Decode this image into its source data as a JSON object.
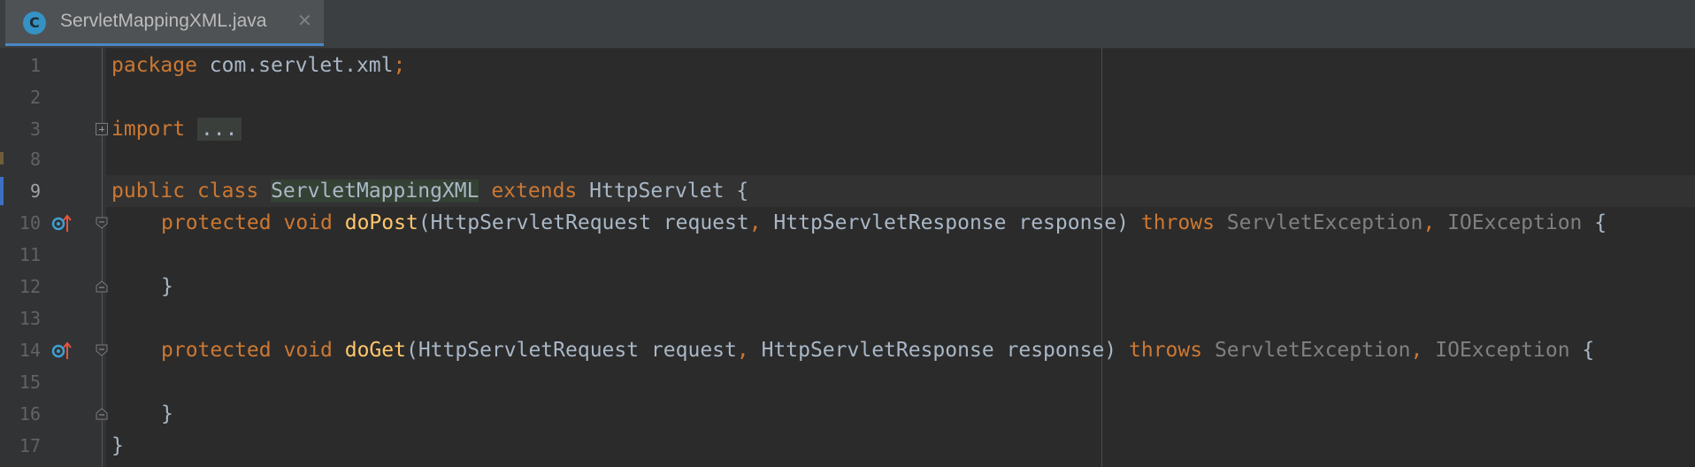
{
  "tab": {
    "icon_letter": "C",
    "file_name": "ServletMappingXML.java",
    "close_glyph": "✕",
    "icon_color": "#3592c4"
  },
  "editor": {
    "active_line": "9",
    "lines": [
      {
        "no": "1"
      },
      {
        "no": "2"
      },
      {
        "no": "3"
      },
      {
        "no": "8"
      },
      {
        "no": "9"
      },
      {
        "no": "10"
      },
      {
        "no": "11"
      },
      {
        "no": "12"
      },
      {
        "no": "13"
      },
      {
        "no": "14"
      },
      {
        "no": "15"
      },
      {
        "no": "16"
      },
      {
        "no": "17"
      }
    ],
    "code": {
      "l1": {
        "kw": "package",
        "pkg": "com.servlet.xml",
        "semi": ";"
      },
      "l3": {
        "kw": "import",
        "dots": "..."
      },
      "l9": {
        "kw_public": "public",
        "kw_class": "class",
        "class_name": "ServletMappingXML",
        "kw_extends": "extends",
        "parent": "HttpServlet",
        "brace": "{"
      },
      "l10": {
        "kw_protected": "protected",
        "kw_void": "void",
        "method": "doPost",
        "params_open": "(HttpServletRequest request",
        "comma": ",",
        "params_rest": " HttpServletResponse response)",
        "kw_throws": "throws",
        "exc1": "ServletException",
        "comma2": ",",
        "exc2": "IOException",
        "brace": "{"
      },
      "l12": {
        "brace": "}"
      },
      "l14": {
        "kw_protected": "protected",
        "kw_void": "void",
        "method": "doGet",
        "params_open": "(HttpServletRequest request",
        "comma": ",",
        "params_rest": " HttpServletResponse response)",
        "kw_throws": "throws",
        "exc1": "ServletException",
        "comma2": ",",
        "exc2": "IOException",
        "brace": "{"
      },
      "l16": {
        "brace": "}"
      },
      "l17": {
        "brace": "}"
      }
    },
    "colors": {
      "keyword": "#cc7832",
      "method": "#ffc66d",
      "text": "#a9b7c6",
      "exception": "#808080",
      "background": "#2b2b2b"
    },
    "icons": [
      "override-icon",
      "fold-expand-icon",
      "fold-collapse-icon"
    ]
  }
}
